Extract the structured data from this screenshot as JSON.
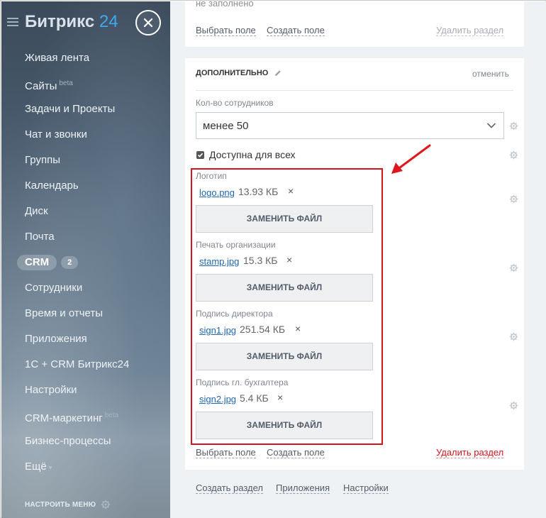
{
  "brand": {
    "name": "Битрикс",
    "number": "24"
  },
  "nav": [
    {
      "label": "Живая лента",
      "sup": ""
    },
    {
      "label": "Сайты",
      "sup": "beta"
    },
    {
      "label": "Задачи и Проекты",
      "sup": ""
    },
    {
      "label": "Чат и звонки",
      "sup": ""
    },
    {
      "label": "Группы",
      "sup": ""
    },
    {
      "label": "Календарь",
      "sup": ""
    },
    {
      "label": "Диск",
      "sup": ""
    },
    {
      "label": "Почта",
      "sup": ""
    },
    {
      "label": "CRM",
      "sup": "",
      "count": "2"
    },
    {
      "label": "Сотрудники",
      "sup": ""
    },
    {
      "label": "Время и отчеты",
      "sup": ""
    },
    {
      "label": "Приложения",
      "sup": ""
    },
    {
      "label": "1С + CRM Битрикс24",
      "sup": ""
    },
    {
      "label": "Настройки",
      "sup": ""
    },
    {
      "label": "CRM-маркетинг",
      "sup": "beta"
    },
    {
      "label": "Бизнес-процессы",
      "sup": ""
    },
    {
      "label": "Ещё",
      "sup": ""
    }
  ],
  "sidebar_settings": "НАСТРОИТЬ МЕНЮ",
  "top_card": {
    "faded_text": "не заполнено",
    "choose_field": "Выбрать поле",
    "create_field": "Создать поле",
    "delete_section": "Удалить раздел"
  },
  "section": {
    "title": "ДОПОЛНИТЕЛЬНО",
    "cancel": "отменить",
    "employees_label": "Кол-во сотрудников",
    "employees_value": "менее 50",
    "available_label": "Доступна для всех",
    "files": [
      {
        "label": "Логотип",
        "name": "logo.png",
        "size": "13.93 КБ"
      },
      {
        "label": "Печать организации",
        "name": "stamp.jpg",
        "size": "15.3 КБ"
      },
      {
        "label": "Подпись директора",
        "name": "sign1.jpg",
        "size": "251.54 КБ"
      },
      {
        "label": "Подпись гл. бухгалтера",
        "name": "sign2.jpg",
        "size": "5.4 КБ"
      }
    ],
    "replace_button": "ЗАМЕНИТЬ ФАЙЛ",
    "remove_symbol": "×",
    "choose_field": "Выбрать поле",
    "create_field": "Создать поле",
    "delete_section": "Удалить раздел"
  },
  "footer_links": {
    "create_section": "Создать раздел",
    "apps": "Приложения",
    "settings": "Настройки"
  },
  "colors": {
    "link_blue": "#2067b0",
    "danger_red": "#d6141c",
    "brand_blue": "#3fa9f5"
  }
}
